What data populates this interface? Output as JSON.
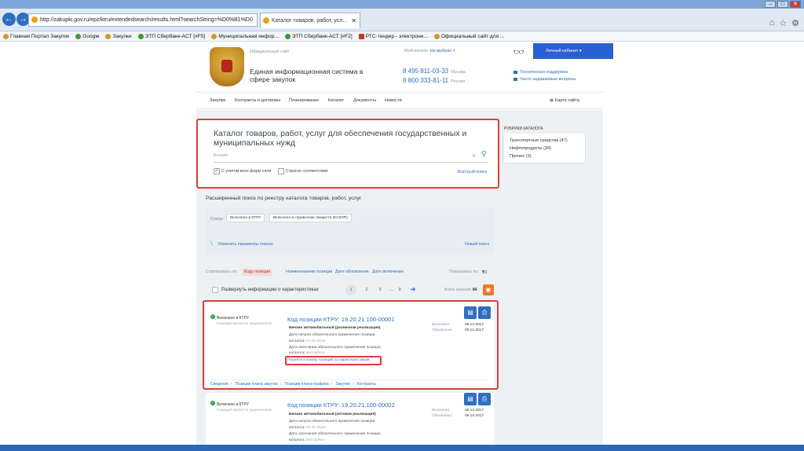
{
  "browser": {
    "url": "http://zakupki.gov.ru/epz/ktru/extendedsearch/results.html?searchString=%D0%B1%D0",
    "tab_title": "Каталог товаров, работ, усл...",
    "favorites": [
      {
        "label": "Главная Портал Закупок"
      },
      {
        "label": "Google"
      },
      {
        "label": "Закупки"
      },
      {
        "label": "ЭТП Сбербанк-АСТ [#F5]"
      },
      {
        "label": "Муниципальная инфор..."
      },
      {
        "label": "ЭТП Сбербанк-АСТ [#F2]"
      },
      {
        "label": "РТС-тендер - электронн..."
      },
      {
        "label": "Официальный сайт для ..."
      }
    ]
  },
  "header": {
    "official_site": "Официальный сайт",
    "title": "Единая информационная система в сфере закупок",
    "region_label": "Мой регион:",
    "region_value": "Не выбран",
    "phone1": "8 495 811-03-33",
    "phone1_city": "Москва",
    "phone2": "8 800 333-81-11",
    "phone2_city": "Россия",
    "cabinet": "Личный кабинет",
    "support": "Техническая поддержка",
    "faq": "Часто задаваемые вопросы"
  },
  "menu": {
    "items": [
      "Закупки",
      "Контракты и договоры",
      "Планирование",
      "Каталог",
      "Документы",
      "Новости"
    ],
    "map": "Карта сайта"
  },
  "search": {
    "title": "Каталог товаров, работ, услуг для обеспечения государственных и муниципальных нужд",
    "value": "Бензин",
    "check1": "С учетом всех форм слов",
    "check2": "Строгое соответствие",
    "quick": "Быстрый поиск"
  },
  "rubrics": {
    "title": "РУБРИКИ КАТАЛОГА",
    "items": [
      "Транспортные средства (47)",
      "Нефтепродукты (34)",
      "Прочее (3)"
    ]
  },
  "ext": {
    "title": "Расширенный поиск по реестру каталога товаров, работ, услуг",
    "status_label": "Статус:",
    "pill1": "Включено в КТРУ",
    "pill2": "Включено в справочник лекарств (ЕСКЛП)",
    "change": "Изменить параметры поиска",
    "new_search": "Новый поиск"
  },
  "sort": {
    "label": "Сортировать по:",
    "active": "Коду позиции",
    "opt1": "Наименованию позиции",
    "opt2": "Дате обновления",
    "opt3": "Дате включения",
    "show_label": "Показывать по:",
    "show_value": "10"
  },
  "pager": {
    "expand": "Развернуть информацию о характеристиках",
    "pages": [
      "1",
      "2",
      "3",
      "...",
      "9"
    ],
    "total_label": "Всего записей:",
    "total_value": "84"
  },
  "cards": [
    {
      "status": "Включено в КТРУ",
      "status_sub": "Позиция является укрупненной",
      "code": "Код позиции КТРУ: 19.20.21.100-00001",
      "name": "Бензин автомобильный (розничная реализация)",
      "l1": "Дата начала обязательного применения позиции",
      "l2": "каталога:",
      "l2v": "01.01.2018",
      "l3": "Дата окончания обязательного применения позиции",
      "l4": "каталога:",
      "l4v": "Бессрочно",
      "included_label": "Включено:",
      "included": "05.12.2017",
      "updated_label": "Обновлено:",
      "updated": "05.12.2017",
      "goto": "Перейти к поиску позиций по характеристикам",
      "links": [
        "Сведения",
        "Позиции плана закупок",
        "Позиции плана-графика",
        "Закупки",
        "Контракты"
      ]
    },
    {
      "status": "Включено в КТРУ",
      "status_sub": "Позиция является укрупненной",
      "code": "Код позиции КТРУ: 19.20.21.100-00002",
      "name": "Бензин автомобильный (оптовая реализация)",
      "l1": "Дата начала обязательного применения позиции",
      "l2": "каталога:",
      "l2v": "01.01.2018",
      "l3": "Дата окончания обязательного применения позиции",
      "l4": "каталога:",
      "l4v": "Бессрочно",
      "included_label": "Включено:",
      "included": "05.12.2017",
      "updated_label": "Обновлено:",
      "updated": "05.12.2017"
    }
  ]
}
